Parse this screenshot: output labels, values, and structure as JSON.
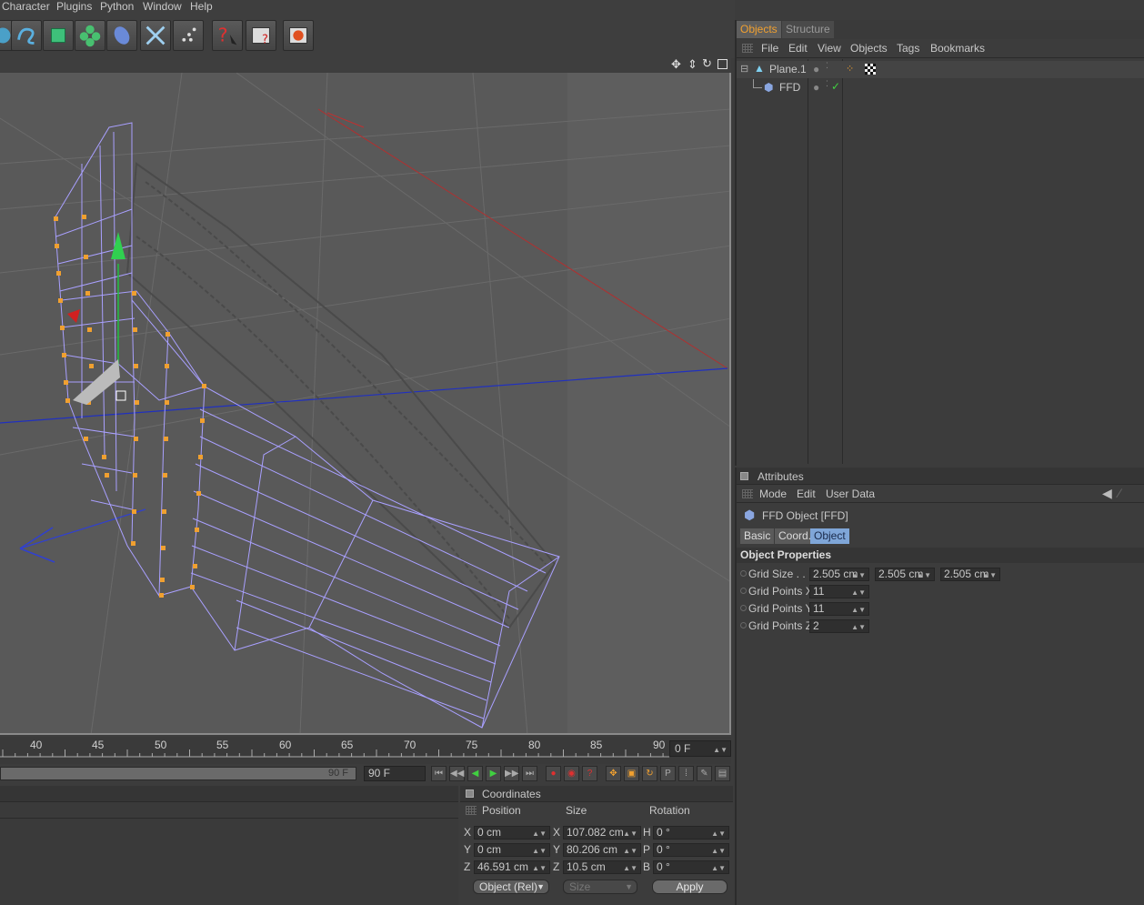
{
  "menubar": {
    "items": [
      "Character",
      "Plugins",
      "Python",
      "Window",
      "Help"
    ]
  },
  "toolbar": {
    "icons": [
      "spline-icon",
      "generator-icon",
      "array-icon",
      "deformer-icon",
      "environment-icon",
      "camera-icon",
      "particle-icon",
      "help-cursor-icon",
      "render-settings-icon",
      "render-view-icon"
    ]
  },
  "timeline": {
    "ticks": [
      "40",
      "45",
      "50",
      "55",
      "60",
      "65",
      "70",
      "75",
      "80",
      "85",
      "90"
    ],
    "current_frame": "0 F",
    "scrub_end": "90 F",
    "end_frame": "90 F"
  },
  "coordinates": {
    "title": "Coordinates",
    "col_position": "Position",
    "col_size": "Size",
    "col_rotation": "Rotation",
    "rows": [
      {
        "axis": "X",
        "pos": "0 cm",
        "size_axis": "X",
        "size": "107.082 cm",
        "rot_axis": "H",
        "rot": "0 °"
      },
      {
        "axis": "Y",
        "pos": "0 cm",
        "size_axis": "Y",
        "size": "80.206 cm",
        "rot_axis": "P",
        "rot": "0 °"
      },
      {
        "axis": "Z",
        "pos": "46.591 cm",
        "size_axis": "Z",
        "size": "10.5 cm",
        "rot_axis": "B",
        "rot": "0 °"
      }
    ],
    "mode_select": "Object (Rel)",
    "size_select": "Size",
    "apply_label": "Apply"
  },
  "objects_panel": {
    "tab_objects": "Objects",
    "tab_structure": "Structure",
    "menu": [
      "File",
      "Edit",
      "View",
      "Objects",
      "Tags",
      "Bookmarks"
    ],
    "tree": [
      {
        "name": "Plane.1",
        "color": "#e8963c"
      },
      {
        "name": "FFD",
        "color": "#f0a030"
      }
    ]
  },
  "attributes_panel": {
    "title": "Attributes",
    "menu": [
      "Mode",
      "Edit",
      "User Data"
    ],
    "object_title": "FFD Object [FFD]",
    "tabs": [
      "Basic",
      "Coord.",
      "Object"
    ],
    "active_tab": "Object",
    "section": "Object Properties",
    "grid_size_label": "Grid Size . . .",
    "grid_size": [
      "2.505 cm",
      "2.505 cm",
      "2.505 cm"
    ],
    "grid_x_label": "Grid Points X",
    "grid_x": "11",
    "grid_y_label": "Grid Points Y",
    "grid_y": "11",
    "grid_z_label": "Grid Points Z",
    "grid_z": "2"
  },
  "colors": {
    "accent_orange": "#f0a030",
    "wire": "#a9a0ff",
    "active_tab": "#7fa6d8"
  }
}
